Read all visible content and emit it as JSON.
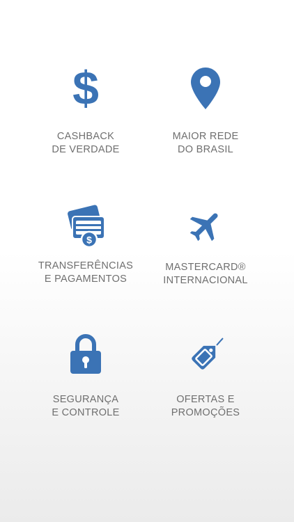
{
  "accent_color": "#3b73b5",
  "text_color": "#6f6f6f",
  "features": [
    {
      "icon": "dollar-icon",
      "line1": "CASHBACK",
      "line2": "DE VERDADE"
    },
    {
      "icon": "map-pin-icon",
      "line1": "MAIOR REDE",
      "line2": "DO BRASIL"
    },
    {
      "icon": "card-transfer-icon",
      "line1": "TRANSFERÊNCIAS",
      "line2": "E PAGAMENTOS"
    },
    {
      "icon": "airplane-icon",
      "line1": "MASTERCARD®",
      "line2": "INTERNACIONAL"
    },
    {
      "icon": "lock-icon",
      "line1": "SEGURANÇA",
      "line2": "E CONTROLE"
    },
    {
      "icon": "price-tag-icon",
      "line1": "OFERTAS E",
      "line2": "PROMOÇÕES"
    }
  ]
}
